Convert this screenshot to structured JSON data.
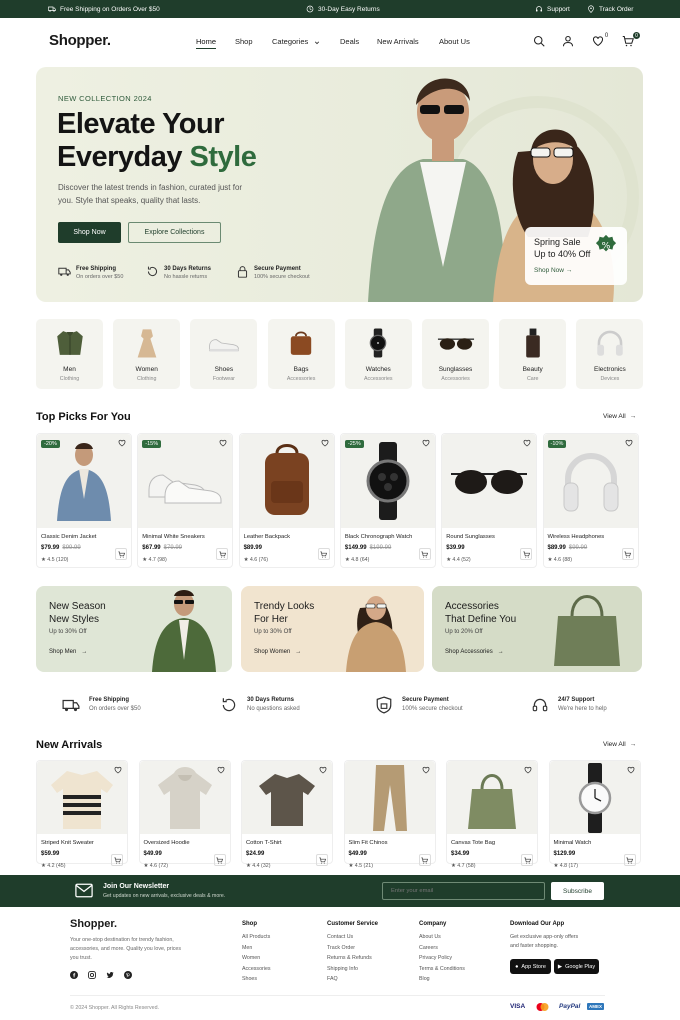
{
  "topbar": {
    "shipping": "Free Shipping on Orders Over $50",
    "returns": "30-Day Easy Returns",
    "support": "Support",
    "track": "Track Order"
  },
  "nav": {
    "logo": "Shopper.",
    "links": [
      "Home",
      "Shop",
      "Categories",
      "Deals",
      "New Arrivals",
      "About Us"
    ],
    "wishlist_count": "0",
    "cart_count": "0"
  },
  "hero": {
    "eyebrow": "NEW COLLECTION 2024",
    "title_line1": "Elevate Your",
    "title_line2_a": "Everyday ",
    "title_line2_b": "Style",
    "description": "Discover the latest trends in fashion, curated just for you. Style that speaks, quality that lasts.",
    "primary_cta": "Shop Now",
    "secondary_cta": "Explore Collections",
    "features": [
      {
        "title": "Free Shipping",
        "sub": "On orders over $50"
      },
      {
        "title": "30 Days Returns",
        "sub": "No hassle returns"
      },
      {
        "title": "Secure Payment",
        "sub": "100% secure checkout"
      }
    ],
    "promo": {
      "title": "Spring Sale",
      "subtitle": "Up to 40% Off",
      "link": "Shop Now",
      "badge_icon": "percent-icon"
    }
  },
  "categories": [
    {
      "name": "Men",
      "sub": "Clothing",
      "icon": "jacket-icon"
    },
    {
      "name": "Women",
      "sub": "Clothing",
      "icon": "dress-icon"
    },
    {
      "name": "Shoes",
      "sub": "Footwear",
      "icon": "sneaker-icon"
    },
    {
      "name": "Bags",
      "sub": "Accessories",
      "icon": "bag-icon"
    },
    {
      "name": "Watches",
      "sub": "Accessories",
      "icon": "watch-icon"
    },
    {
      "name": "Sunglasses",
      "sub": "Accessories",
      "icon": "sunglasses-icon"
    },
    {
      "name": "Beauty",
      "sub": "Care",
      "icon": "perfume-icon"
    },
    {
      "name": "Electronics",
      "sub": "Devices",
      "icon": "headphones-icon"
    }
  ],
  "top_picks": {
    "title": "Top Picks For You",
    "view_all": "View All",
    "products": [
      {
        "name": "Classic Denim Jacket",
        "price": "$79.99",
        "old": "$99.99",
        "rating": "★ 4.5 (120)",
        "discount": "-20%",
        "icon": "denim-jacket"
      },
      {
        "name": "Minimal White Sneakers",
        "price": "$67.99",
        "old": "$79.99",
        "rating": "★ 4.7 (98)",
        "discount": "-15%",
        "icon": "sneakers"
      },
      {
        "name": "Leather Backpack",
        "price": "$89.99",
        "old": "",
        "rating": "★ 4.6 (76)",
        "discount": "",
        "icon": "backpack"
      },
      {
        "name": "Black Chronograph Watch",
        "price": "$149.99",
        "old": "$199.99",
        "rating": "★ 4.8 (64)",
        "discount": "-25%",
        "icon": "watch"
      },
      {
        "name": "Round Sunglasses",
        "price": "$39.99",
        "old": "",
        "rating": "★ 4.4 (52)",
        "discount": "",
        "icon": "sunglasses"
      },
      {
        "name": "Wireless Headphones",
        "price": "$89.99",
        "old": "$99.99",
        "rating": "★ 4.6 (88)",
        "discount": "-10%",
        "icon": "headphones"
      }
    ]
  },
  "banners": [
    {
      "line1": "New Season",
      "line2": "New Styles",
      "offer": "Up to 30% Off",
      "cta": "Shop Men",
      "bg": "#dfe6d6"
    },
    {
      "line1": "Trendy Looks",
      "line2": "For Her",
      "offer": "Up to 30% Off",
      "cta": "Shop Women",
      "bg": "#f1e4cf"
    },
    {
      "line1": "Accessories",
      "line2": "That Define You",
      "offer": "Up to 20% Off",
      "cta": "Shop Accessories",
      "bg": "#d5dcc7"
    }
  ],
  "features": [
    {
      "title": "Free Shipping",
      "sub": "On orders over $50"
    },
    {
      "title": "30 Days Returns",
      "sub": "No questions asked"
    },
    {
      "title": "Secure Payment",
      "sub": "100% secure checkout"
    },
    {
      "title": "24/7 Support",
      "sub": "We're here to help"
    }
  ],
  "new_arrivals": {
    "title": "New Arrivals",
    "view_all": "View All",
    "products": [
      {
        "name": "Striped Knit Sweater",
        "price": "$59.99",
        "rating": "★ 4.2 (45)",
        "icon": "sweater"
      },
      {
        "name": "Oversized Hoodie",
        "price": "$49.99",
        "rating": "★ 4.6 (72)",
        "icon": "hoodie"
      },
      {
        "name": "Cotton T-Shirt",
        "price": "$24.99",
        "rating": "★ 4.4 (32)",
        "icon": "tshirt"
      },
      {
        "name": "Slim Fit Chinos",
        "price": "$49.99",
        "rating": "★ 4.5 (21)",
        "icon": "chinos"
      },
      {
        "name": "Canvas Tote Bag",
        "price": "$34.99",
        "rating": "★ 4.7 (58)",
        "icon": "tote"
      },
      {
        "name": "Minimal Watch",
        "price": "$129.99",
        "rating": "★ 4.8 (17)",
        "icon": "minimal-watch"
      }
    ]
  },
  "newsletter": {
    "title": "Join Our Newsletter",
    "sub": "Get updates on new arrivals, exclusive deals & more.",
    "placeholder": "Enter your email",
    "button": "Subscribe"
  },
  "footer": {
    "logo": "Shopper.",
    "desc": "Your one-stop destination for trendy fashion, accessories, and more. Quality you love, prices you trust.",
    "columns": [
      {
        "title": "Shop",
        "links": [
          "All Products",
          "Men",
          "Women",
          "Accessories",
          "Shoes"
        ]
      },
      {
        "title": "Customer Service",
        "links": [
          "Contact Us",
          "Track Order",
          "Returns & Refunds",
          "Shipping Info",
          "FAQ"
        ]
      },
      {
        "title": "Company",
        "links": [
          "About Us",
          "Careers",
          "Privacy Policy",
          "Terms & Conditions",
          "Blog"
        ]
      }
    ],
    "app": {
      "title": "Download Our App",
      "sub": "Get exclusive app-only offers and faster shopping.",
      "app_store": "App Store",
      "google_play": "Google Play"
    },
    "copyright": "© 2024 Shopper. All Rights Reserved.",
    "payments": [
      "VISA",
      "PayPal",
      "AMEX"
    ]
  },
  "colors": {
    "brand": "#1f3d2b",
    "accent": "#2f6b3d"
  }
}
